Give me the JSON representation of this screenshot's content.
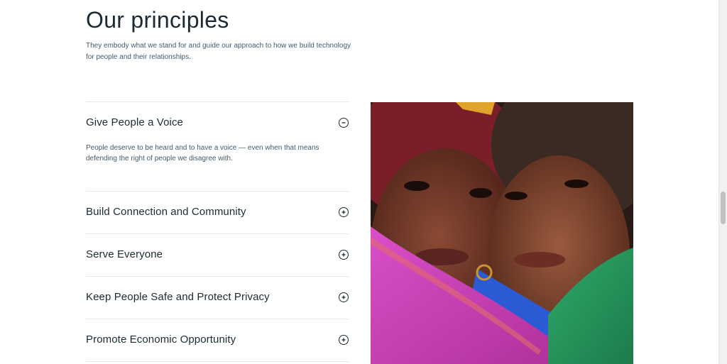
{
  "header": {
    "title": "Our principles",
    "subtitle": "They embody what we stand for and guide our approach to how we build technology for people and their relationships."
  },
  "principles": [
    {
      "title": "Give People a Voice",
      "expanded": true,
      "toggle_icon": "minus-circle-icon",
      "body": "People deserve to be heard and to have a voice — even when that means defending the right of people we disagree with."
    },
    {
      "title": "Build Connection and Community",
      "expanded": false,
      "toggle_icon": "plus-circle-icon"
    },
    {
      "title": "Serve Everyone",
      "expanded": false,
      "toggle_icon": "plus-circle-icon"
    },
    {
      "title": "Keep People Safe and Protect Privacy",
      "expanded": false,
      "toggle_icon": "plus-circle-icon"
    },
    {
      "title": "Promote Economic Opportunity",
      "expanded": false,
      "toggle_icon": "plus-circle-icon"
    }
  ],
  "image": {
    "subject": "two smiling people wrapped in a rainbow flag"
  },
  "colors": {
    "text": "#1c2b33",
    "secondary_text": "#465a69",
    "divider": "#e4e6eb"
  }
}
